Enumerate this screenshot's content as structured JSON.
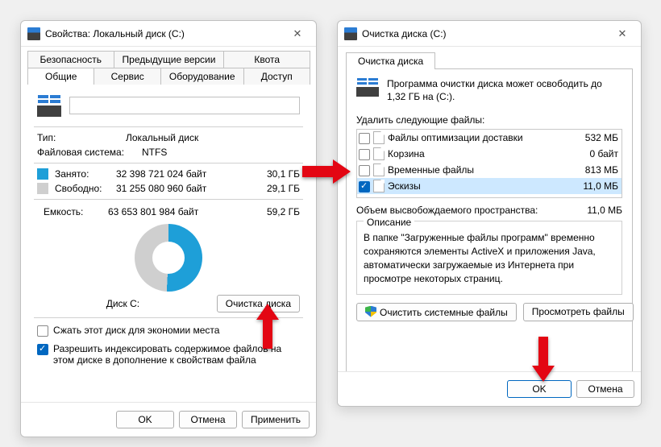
{
  "left": {
    "title": "Свойства: Локальный диск (C:)",
    "tabs_row1": [
      "Безопасность",
      "Предыдущие версии",
      "Квота"
    ],
    "tabs_row2": [
      "Общие",
      "Сервис",
      "Оборудование",
      "Доступ"
    ],
    "active_tab": "Общие",
    "drive_name": "",
    "type_label": "Тип:",
    "type_value": "Локальный диск",
    "fs_label": "Файловая система:",
    "fs_value": "NTFS",
    "used_label": "Занято:",
    "used_bytes": "32 398 721 024 байт",
    "used_gb": "30,1 ГБ",
    "free_label": "Свободно:",
    "free_bytes": "31 255 080 960 байт",
    "free_gb": "29,1 ГБ",
    "capacity_label": "Емкость:",
    "capacity_bytes": "63 653 801 984 байт",
    "capacity_gb": "59,2 ГБ",
    "disk_label": "Диск C:",
    "cleanup_button": "Очистка диска",
    "compress_label": "Сжать этот диск для экономии места",
    "index_label": "Разрешить индексировать содержимое файлов на этом диске в дополнение к свойствам файла",
    "ok": "OK",
    "cancel": "Отмена",
    "apply": "Применить"
  },
  "right": {
    "title": "Очистка диска  (C:)",
    "tab": "Очистка диска",
    "info_text": "Программа очистки диска может освободить до 1,32 ГБ на  (С:).",
    "delete_label": "Удалить следующие файлы:",
    "files": [
      {
        "checked": false,
        "name": "Файлы оптимизации доставки",
        "size": "532 МБ"
      },
      {
        "checked": false,
        "name": "Корзина",
        "size": "0 байт"
      },
      {
        "checked": false,
        "name": "Временные файлы",
        "size": "813 МБ"
      },
      {
        "checked": true,
        "name": "Эскизы",
        "size": "11,0 МБ"
      }
    ],
    "freed_label": "Объем высвобождаемого пространства:",
    "freed_value": "11,0 МБ",
    "desc_legend": "Описание",
    "desc_text": "В папке \"Загруженные файлы программ\" временно сохраняются элементы ActiveX и приложения Java, автоматически загружаемые из Интернета при просмотре некоторых страниц.",
    "clean_sys_button": "Очистить системные файлы",
    "view_files_button": "Просмотреть файлы",
    "ok": "OK",
    "cancel": "Отмена"
  }
}
